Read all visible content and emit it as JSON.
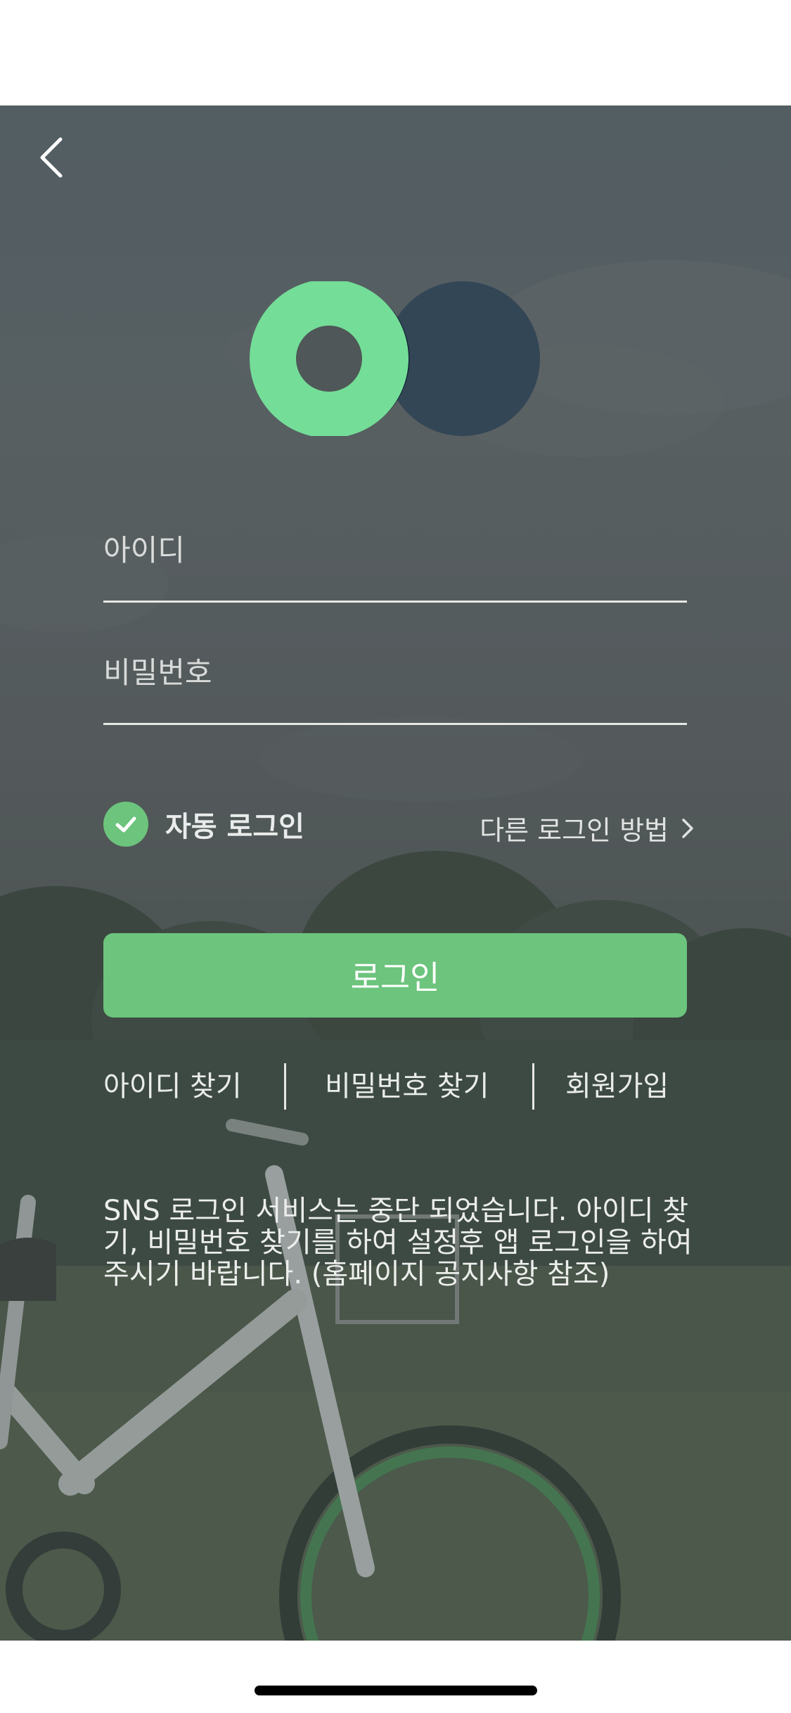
{
  "form": {
    "id_placeholder": "아이디",
    "password_placeholder": "비밀번호",
    "auto_login_label": "자동 로그인",
    "auto_login_checked": true,
    "other_login_label": "다른 로그인 방법",
    "login_button_label": "로그인"
  },
  "links": {
    "find_id": "아이디 찾기",
    "find_password": "비밀번호 찾기",
    "signup": "회원가입"
  },
  "notice": {
    "line1": "SNS 로그인 서비스는 중단 되었습니다. 아이디 찾",
    "line2": "기, 비밀번호 찾기를 하여 설정후 앱 로그인을 하여",
    "line3": "주시기 바랍니다. (홈페이지 공지사항 참조)"
  },
  "colors": {
    "accent": "#6cc47d",
    "logo_green": "#74dd98",
    "logo_dark": "#334656",
    "logo_overlap": "#0f2130",
    "overlay": "#4f5758"
  },
  "icons": {
    "back": "back-chevron-icon",
    "check": "checkmark-icon",
    "other_login": "chevron-right-icon"
  }
}
